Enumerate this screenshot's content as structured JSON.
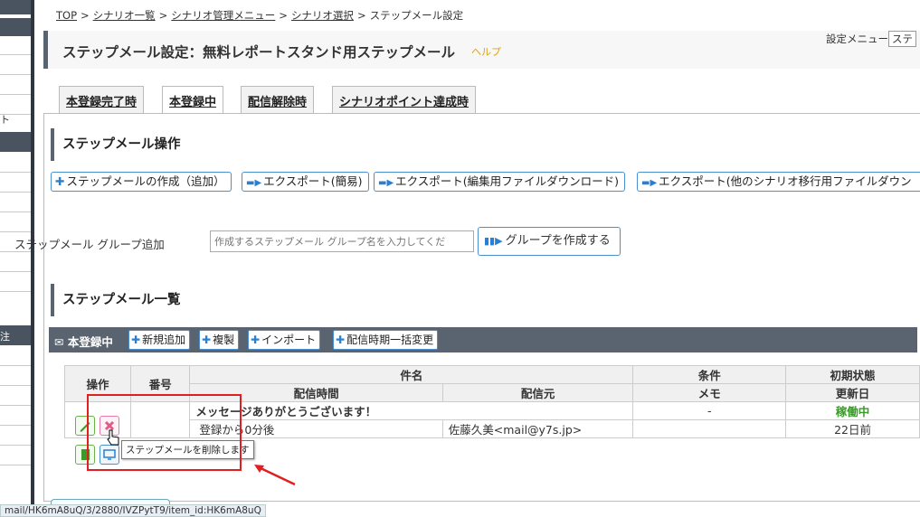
{
  "breadcrumb": {
    "items": [
      "TOP",
      "シナリオ一覧",
      "シナリオ管理メニュー",
      "シナリオ選択"
    ],
    "current": "ステップメール設定",
    "separator": ">"
  },
  "page": {
    "title": "ステップメール設定：無料レポートスタンド用ステップメール",
    "help": "ヘルプ",
    "settings_menu_label": "設定メニュー",
    "settings_menu_value": "ステ"
  },
  "tabs": [
    {
      "label": "本登録完了時",
      "active": false
    },
    {
      "label": "本登録中",
      "active": true
    },
    {
      "label": "配信解除時",
      "active": false
    },
    {
      "label": "シナリオポイント達成時",
      "active": false
    }
  ],
  "operations": {
    "heading": "ステップメール操作",
    "buttons": {
      "create": "ステップメールの作成（追加）",
      "export_simple": "エクスポート(簡易)",
      "export_edit": "エクスポート(編集用ファイルダウンロード)",
      "export_other": "エクスポート(他のシナリオ移行用ファイルダウン"
    }
  },
  "group": {
    "label": "ステップメール グループ追加",
    "placeholder": "作成するステップメール グループ名を入力してくだ",
    "create_button": "グループを作成する"
  },
  "list": {
    "heading": "ステップメール一覧",
    "bar_label": "本登録中",
    "bar_buttons": {
      "add": "新規追加",
      "copy": "複製",
      "import": "インポート",
      "bulk_change": "配信時期一括変更"
    },
    "headers": {
      "op": "操作",
      "num": "番号",
      "subject": "件名",
      "condition": "条件",
      "initial_state": "初期状態",
      "send_time": "配信時間",
      "sender": "配信元",
      "memo": "メモ",
      "updated": "更新日"
    },
    "rows": [
      {
        "subject": "メッセージありがとうございます！",
        "condition": "-",
        "status": "稼働中",
        "send_time": "登録から0分後",
        "sender": "佐藤久美<mail@y7s.jp>",
        "memo": "",
        "updated": "22日前"
      }
    ]
  },
  "tooltip": "ステップメールを削除します",
  "status_url": "mail/HK6mA8uQ/3/2880/IVZPytT9/item_id:HK6mA8uQ",
  "sidebar_fragment": "ト",
  "sidebar_fragment2": "注",
  "colors": {
    "accent_blue": "#2a7fd0",
    "active_green": "#3a9a2a",
    "bar_gray": "#5a6470",
    "highlight_red": "#e02020",
    "help_orange": "#e6a200"
  }
}
